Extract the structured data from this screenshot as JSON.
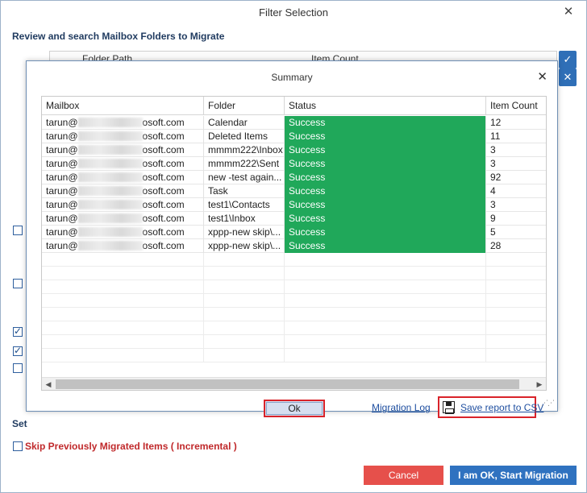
{
  "outer": {
    "title": "Filter Selection",
    "close_glyph": "✕",
    "heading": "Review and search Mailbox Folders to Migrate",
    "bg_columns": [
      "Folder Path",
      "Item Count"
    ],
    "side_buttons": [
      "✓",
      "✕"
    ],
    "set_label": "Set",
    "skip_label": "Skip Previously Migrated Items ( Incremental )",
    "cancel_label": "Cancel",
    "start_label": "I am OK, Start Migration"
  },
  "dialog": {
    "title": "Summary",
    "close_glyph": "✕",
    "columns": [
      "Mailbox",
      "Folder",
      "Status",
      "Item Count"
    ],
    "rows": [
      {
        "mailbox_prefix": "tarun@",
        "mailbox_suffix": "osoft.com",
        "folder": "Calendar",
        "status": "Success",
        "count": "12"
      },
      {
        "mailbox_prefix": "tarun@",
        "mailbox_suffix": "osoft.com",
        "folder": "Deleted Items",
        "status": "Success",
        "count": "11"
      },
      {
        "mailbox_prefix": "tarun@",
        "mailbox_suffix": "osoft.com",
        "folder": "mmmm222\\Inbox",
        "status": "Success",
        "count": "3"
      },
      {
        "mailbox_prefix": "tarun@",
        "mailbox_suffix": "osoft.com",
        "folder": "mmmm222\\Sent",
        "status": "Success",
        "count": "3"
      },
      {
        "mailbox_prefix": "tarun@",
        "mailbox_suffix": "osoft.com",
        "folder": "new -test again...",
        "status": "Success",
        "count": "92"
      },
      {
        "mailbox_prefix": "tarun@",
        "mailbox_suffix": "osoft.com",
        "folder": "Task",
        "status": "Success",
        "count": "4"
      },
      {
        "mailbox_prefix": "tarun@",
        "mailbox_suffix": "osoft.com",
        "folder": "test1\\Contacts",
        "status": "Success",
        "count": "3"
      },
      {
        "mailbox_prefix": "tarun@",
        "mailbox_suffix": "osoft.com",
        "folder": "test1\\Inbox",
        "status": "Success",
        "count": "9"
      },
      {
        "mailbox_prefix": "tarun@",
        "mailbox_suffix": "osoft.com",
        "folder": "xppp-new skip\\...",
        "status": "Success",
        "count": "5"
      },
      {
        "mailbox_prefix": "tarun@",
        "mailbox_suffix": "osoft.com",
        "folder": "xppp-new skip\\...",
        "status": "Success",
        "count": "28"
      }
    ],
    "ok_label": "Ok",
    "migration_log_label": "Migration Log",
    "save_report_label": "Save report to CSV",
    "scroll_left": "◀",
    "scroll_right": "▶"
  },
  "colors": {
    "success": "#20a85a",
    "cancel": "#e6504b",
    "start": "#2f72c0",
    "highlight_border": "#d9232a",
    "link": "#1f4fa0"
  }
}
